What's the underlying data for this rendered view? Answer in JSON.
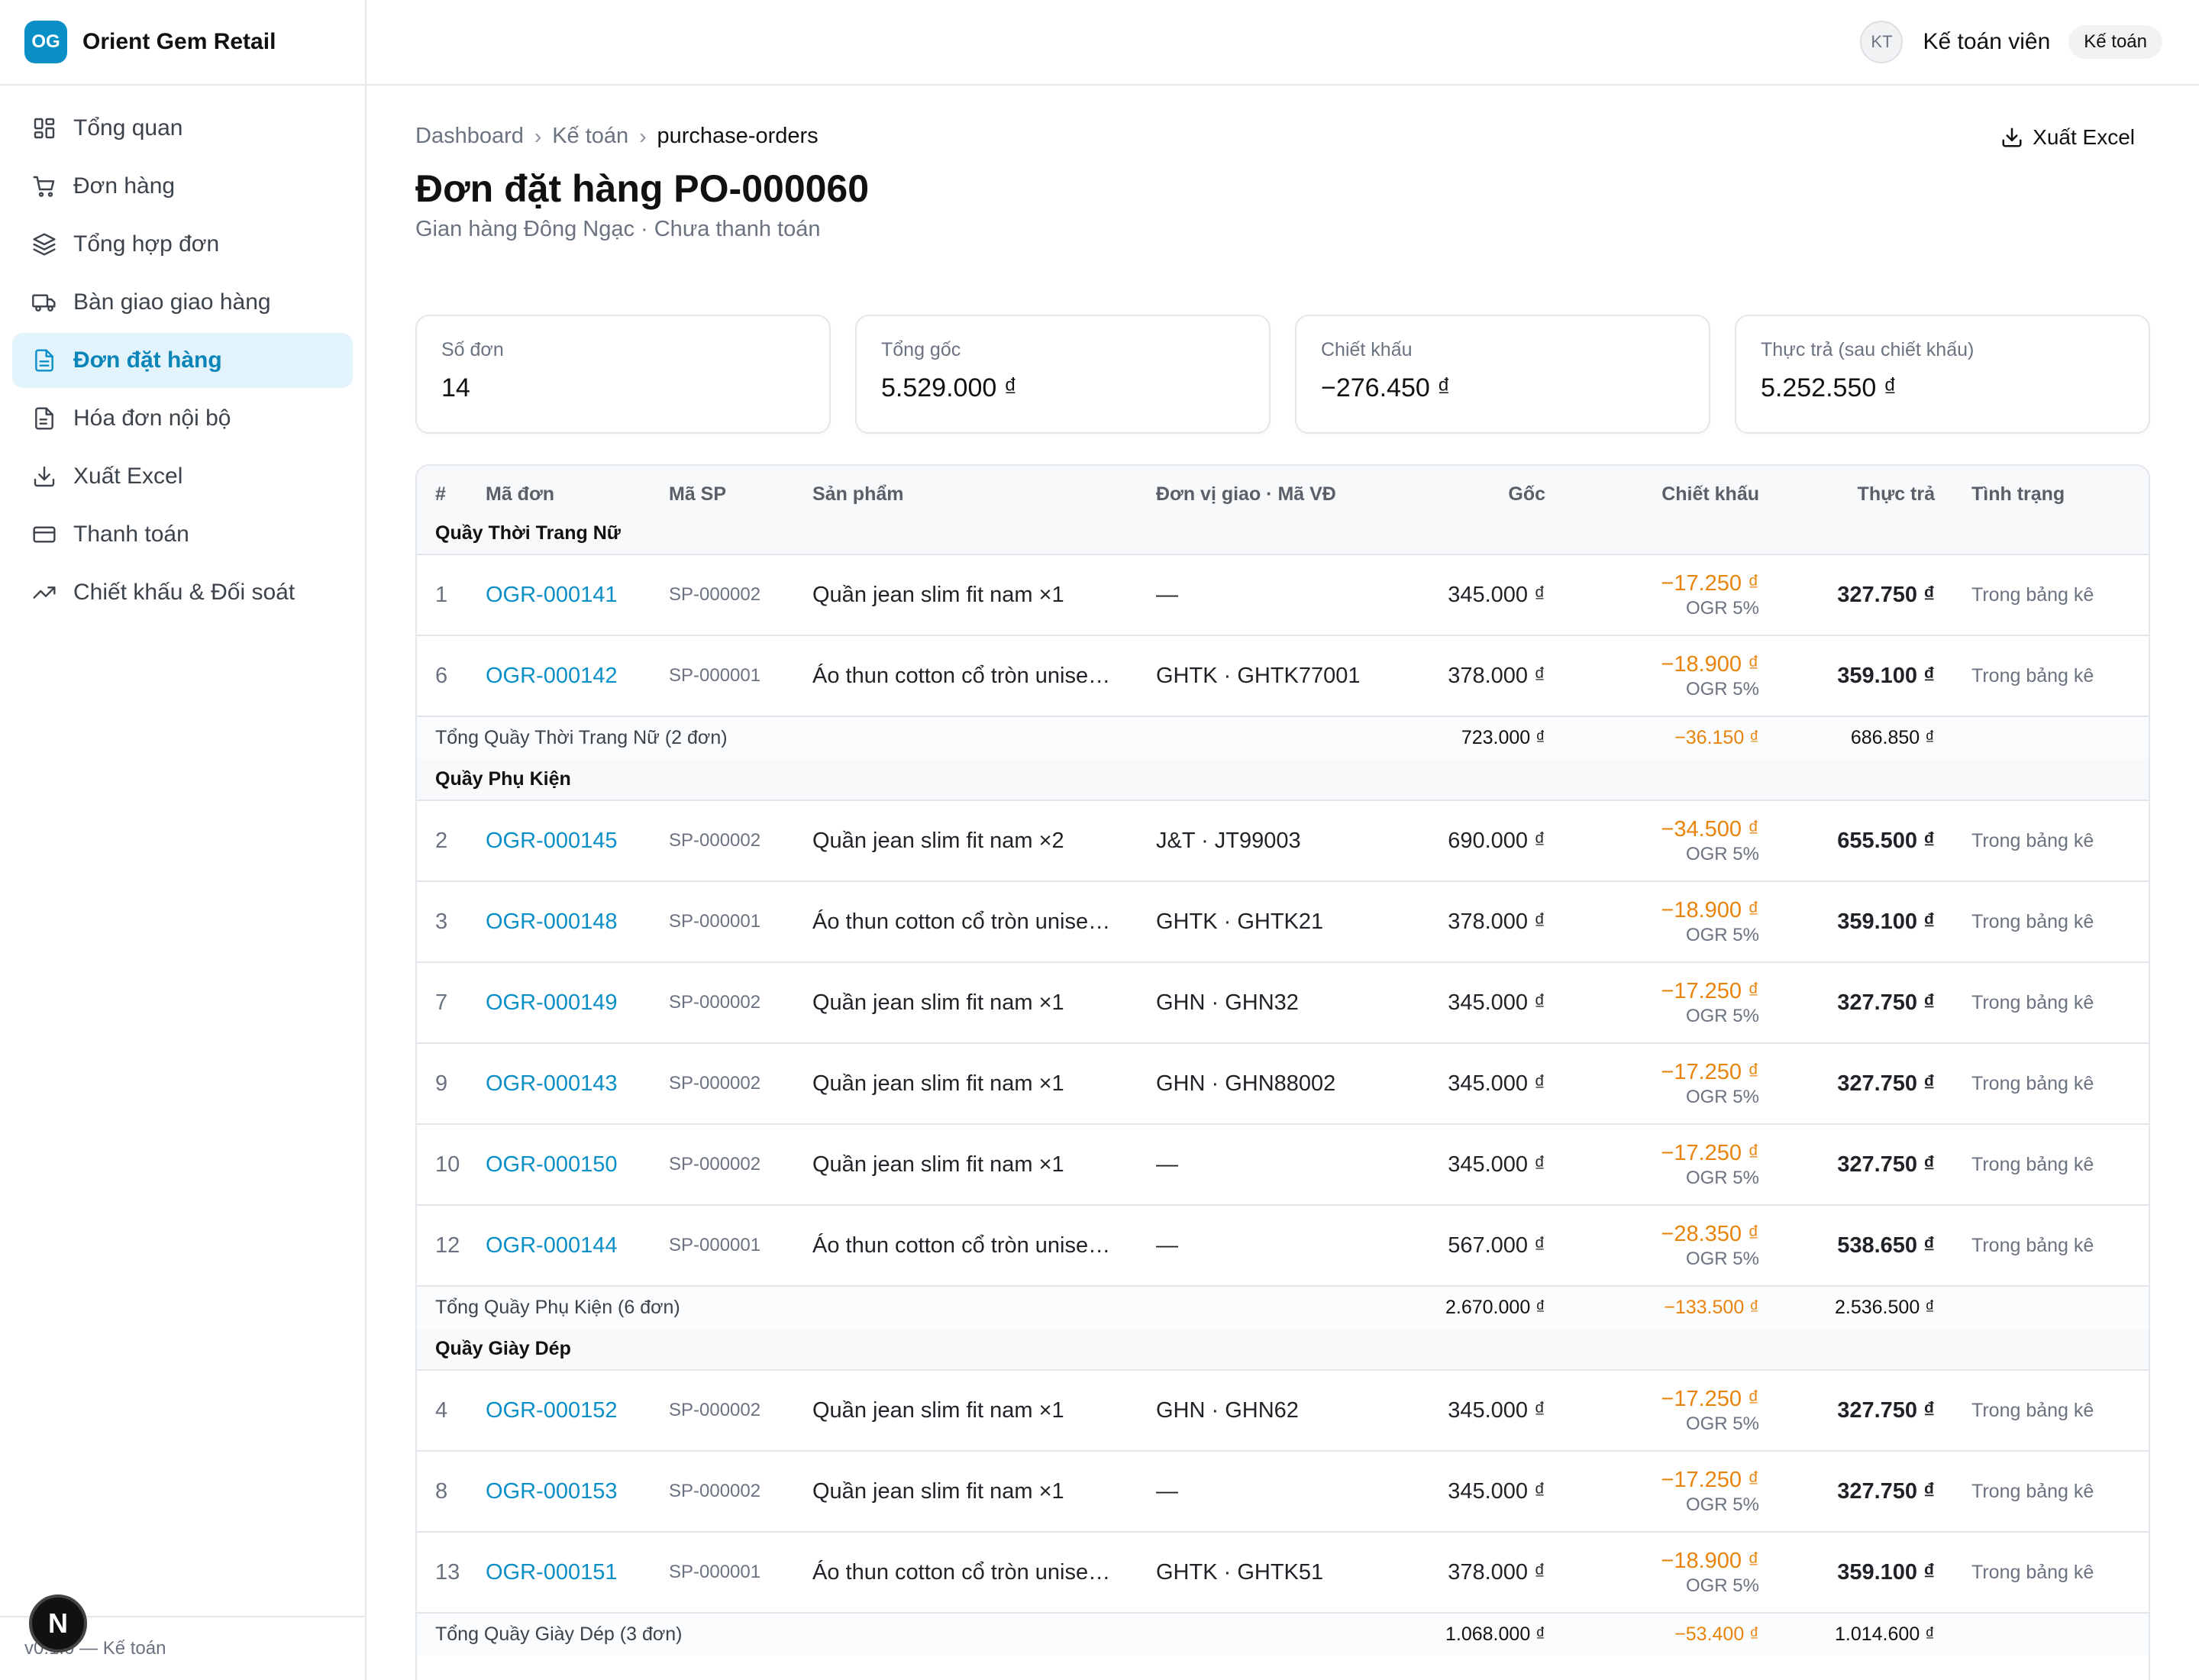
{
  "brand": {
    "logo_text": "OG",
    "name": "Orient Gem Retail"
  },
  "sidebar": {
    "items": [
      {
        "label": "Tổng quan",
        "icon": "dashboard-icon",
        "active": false
      },
      {
        "label": "Đơn hàng",
        "icon": "cart-icon",
        "active": false
      },
      {
        "label": "Tổng hợp đơn",
        "icon": "layers-icon",
        "active": false
      },
      {
        "label": "Bàn giao giao hàng",
        "icon": "truck-icon",
        "active": false
      },
      {
        "label": "Đơn đặt hàng",
        "icon": "document-icon",
        "active": true
      },
      {
        "label": "Hóa đơn nội bộ",
        "icon": "invoice-icon",
        "active": false
      },
      {
        "label": "Xuất Excel",
        "icon": "download-icon",
        "active": false
      },
      {
        "label": "Thanh toán",
        "icon": "card-icon",
        "active": false
      },
      {
        "label": "Chiết khấu & Đối soát",
        "icon": "trending-icon",
        "active": false
      }
    ],
    "footer": "v0.1.0 — Kế toán",
    "dev_badge": "N"
  },
  "topbar": {
    "avatar_initials": "KT",
    "user_name": "Kế toán viên",
    "role": "Kế toán"
  },
  "breadcrumb": {
    "items": [
      "Dashboard",
      "Kế toán"
    ],
    "current": "purchase-orders"
  },
  "header": {
    "title": "Đơn đặt hàng PO-000060",
    "subtitle": "Gian hàng Đông Ngạc · Chưa thanh toán",
    "export_label": "Xuất Excel"
  },
  "stats": [
    {
      "label": "Số đơn",
      "value": "14"
    },
    {
      "label": "Tổng gốc",
      "value": "5.529.000 ₫"
    },
    {
      "label": "Chiết khấu",
      "value": "−276.450 ₫"
    },
    {
      "label": "Thực trả (sau chiết khấu)",
      "value": "5.252.550 ₫"
    }
  ],
  "table": {
    "columns": [
      "#",
      "Mã đơn",
      "Mã SP",
      "Sản phẩm",
      "Đơn vị giao · Mã VĐ",
      "Gốc",
      "Chiết khấu",
      "Thực trả",
      "Tình trạng"
    ],
    "groups": [
      {
        "name": "Quầy Thời Trang Nữ",
        "rows": [
          {
            "idx": "1",
            "code": "OGR-000141",
            "sku": "SP-000002",
            "product": "Quần jean slim fit nam ×1",
            "carrier": "—",
            "gross": "345.000 ₫",
            "discount": "−17.250 ₫",
            "discount_note": "OGR 5%",
            "net": "327.750 ₫",
            "status": "Trong bảng kê"
          },
          {
            "idx": "6",
            "code": "OGR-000142",
            "sku": "SP-000001",
            "product": "Áo thun cotton cổ tròn unise…",
            "carrier": "GHTK · GHTK77001",
            "gross": "378.000 ₫",
            "discount": "−18.900 ₫",
            "discount_note": "OGR 5%",
            "net": "359.100 ₫",
            "status": "Trong bảng kê"
          }
        ],
        "subtotal": {
          "label": "Tổng Quầy Thời Trang Nữ (2 đơn)",
          "gross": "723.000 ₫",
          "discount": "−36.150 ₫",
          "net": "686.850 ₫"
        }
      },
      {
        "name": "Quầy Phụ Kiện",
        "rows": [
          {
            "idx": "2",
            "code": "OGR-000145",
            "sku": "SP-000002",
            "product": "Quần jean slim fit nam ×2",
            "carrier": "J&T · JT99003",
            "gross": "690.000 ₫",
            "discount": "−34.500 ₫",
            "discount_note": "OGR 5%",
            "net": "655.500 ₫",
            "status": "Trong bảng kê"
          },
          {
            "idx": "3",
            "code": "OGR-000148",
            "sku": "SP-000001",
            "product": "Áo thun cotton cổ tròn unise…",
            "carrier": "GHTK · GHTK21",
            "gross": "378.000 ₫",
            "discount": "−18.900 ₫",
            "discount_note": "OGR 5%",
            "net": "359.100 ₫",
            "status": "Trong bảng kê"
          },
          {
            "idx": "7",
            "code": "OGR-000149",
            "sku": "SP-000002",
            "product": "Quần jean slim fit nam ×1",
            "carrier": "GHN · GHN32",
            "gross": "345.000 ₫",
            "discount": "−17.250 ₫",
            "discount_note": "OGR 5%",
            "net": "327.750 ₫",
            "status": "Trong bảng kê"
          },
          {
            "idx": "9",
            "code": "OGR-000143",
            "sku": "SP-000002",
            "product": "Quần jean slim fit nam ×1",
            "carrier": "GHN · GHN88002",
            "gross": "345.000 ₫",
            "discount": "−17.250 ₫",
            "discount_note": "OGR 5%",
            "net": "327.750 ₫",
            "status": "Trong bảng kê"
          },
          {
            "idx": "10",
            "code": "OGR-000150",
            "sku": "SP-000002",
            "product": "Quần jean slim fit nam ×1",
            "carrier": "—",
            "gross": "345.000 ₫",
            "discount": "−17.250 ₫",
            "discount_note": "OGR 5%",
            "net": "327.750 ₫",
            "status": "Trong bảng kê"
          },
          {
            "idx": "12",
            "code": "OGR-000144",
            "sku": "SP-000001",
            "product": "Áo thun cotton cổ tròn unise…",
            "carrier": "—",
            "gross": "567.000 ₫",
            "discount": "−28.350 ₫",
            "discount_note": "OGR 5%",
            "net": "538.650 ₫",
            "status": "Trong bảng kê"
          }
        ],
        "subtotal": {
          "label": "Tổng Quầy Phụ Kiện (6 đơn)",
          "gross": "2.670.000 ₫",
          "discount": "−133.500 ₫",
          "net": "2.536.500 ₫"
        }
      },
      {
        "name": "Quầy Giày Dép",
        "rows": [
          {
            "idx": "4",
            "code": "OGR-000152",
            "sku": "SP-000002",
            "product": "Quần jean slim fit nam ×1",
            "carrier": "GHN · GHN62",
            "gross": "345.000 ₫",
            "discount": "−17.250 ₫",
            "discount_note": "OGR 5%",
            "net": "327.750 ₫",
            "status": "Trong bảng kê"
          },
          {
            "idx": "8",
            "code": "OGR-000153",
            "sku": "SP-000002",
            "product": "Quần jean slim fit nam ×1",
            "carrier": "—",
            "gross": "345.000 ₫",
            "discount": "−17.250 ₫",
            "discount_note": "OGR 5%",
            "net": "327.750 ₫",
            "status": "Trong bảng kê"
          },
          {
            "idx": "13",
            "code": "OGR-000151",
            "sku": "SP-000001",
            "product": "Áo thun cotton cổ tròn unise…",
            "carrier": "GHTK · GHTK51",
            "gross": "378.000 ₫",
            "discount": "−18.900 ₫",
            "discount_note": "OGR 5%",
            "net": "359.100 ₫",
            "status": "Trong bảng kê"
          }
        ],
        "subtotal": {
          "label": "Tổng Quầy Giày Dép (3 đơn)",
          "gross": "1.068.000 ₫",
          "discount": "−53.400 ₫",
          "net": "1.014.600 ₫"
        }
      }
    ]
  },
  "colors": {
    "accent": "#0b8fc7",
    "discount": "#e8830c",
    "active_bg": "#e3f3fb"
  }
}
